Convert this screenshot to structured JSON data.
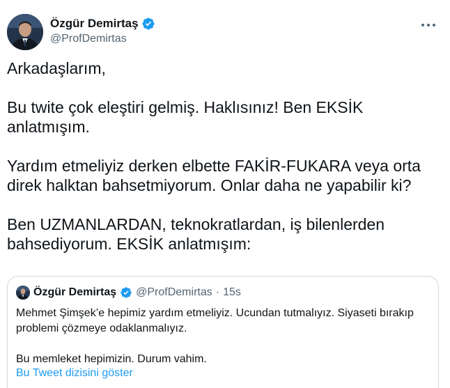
{
  "author": {
    "display_name": "Özgür Demirtaş",
    "handle": "@ProfDemirtas",
    "verified_icon": "verified-badge-icon"
  },
  "more_icon": "more-horizontal-icon",
  "tweet": {
    "paragraphs": [
      "Arkadaşlarım,",
      "Bu twite çok eleştiri gelmiş. Haklısınız! Ben EKSİK anlatmışım.",
      "Yardım etmeliyiz derken elbette FAKİR-FUKARA veya orta direk halktan bahsetmiyorum. Onlar daha ne yapabilir ki?",
      "Ben UZMANLARDAN, teknokratlardan, iş bilenlerden bahsediyorum. EKSİK anlatmışım:"
    ]
  },
  "quoted": {
    "display_name": "Özgür Demirtaş",
    "handle": "@ProfDemirtas",
    "separator": "·",
    "time": "15s",
    "paragraphs": [
      "Mehmet Şimşek’e hepimiz yardım etmeliyiz. Ucundan tutmalıyız. Siyaseti bırakıp problemi çözmeye odaklanmalıyız.",
      "Bu memleket hepimizin. Durum vahim."
    ],
    "show_thread_label": "Bu Tweet dizisini göster"
  },
  "colors": {
    "text_primary": "#0f1419",
    "text_secondary": "#536471",
    "link": "#1d9bf0",
    "verified": "#1d9bf0",
    "border": "#cfd9de"
  }
}
